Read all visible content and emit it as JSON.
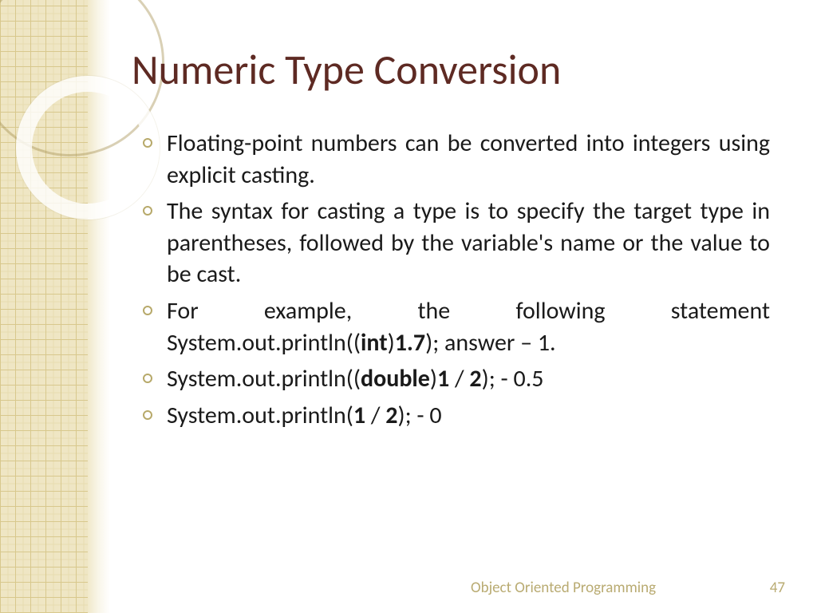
{
  "title": "Numeric Type Conversion",
  "bullets": [
    {
      "html": "Floating-point numbers can be converted into integers using explicit casting."
    },
    {
      "html": "The syntax for casting a type is to specify the target type in parentheses, followed by the variable's name or the value to be cast."
    },
    {
      "html": "For example, the following statement System.out.println((<b>int</b>)<b>1.7</b>); answer – 1."
    },
    {
      "html": "System.out.println((<b>double</b>)<b>1</b> / <b>2</b>); - 0.5"
    },
    {
      "html": "System.out.println(<b>1</b> / <b>2</b>); - 0"
    }
  ],
  "footer": {
    "label": "Object Oriented Programming",
    "page": "47"
  }
}
